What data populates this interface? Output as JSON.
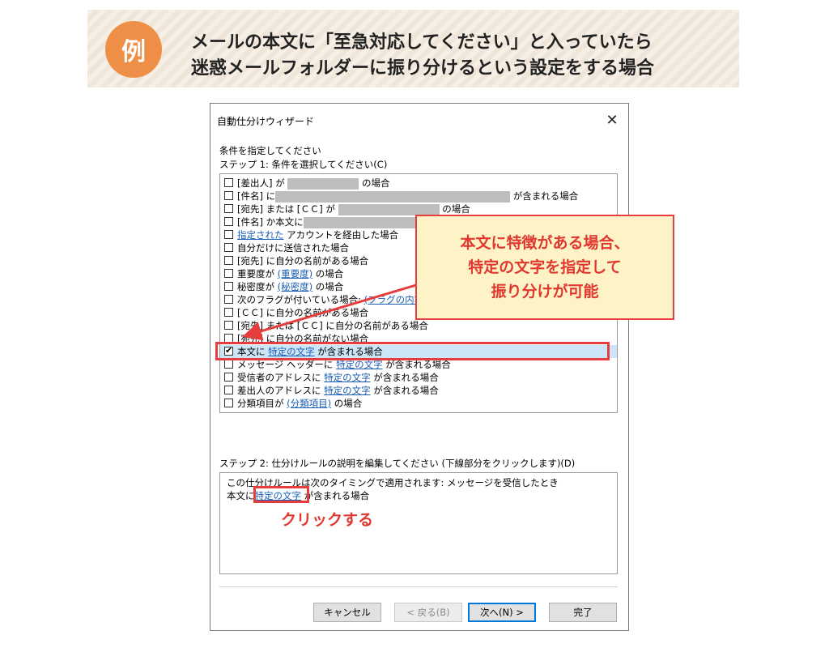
{
  "banner": {
    "badge": "例",
    "line1": "メールの本文に「至急対応してください」と入っていたら",
    "line2": "迷惑メールフォルダーに振り分けるという設定をする場合"
  },
  "dialog": {
    "title": "自動仕分けウィザード",
    "close_glyph": "✕",
    "instruction": "条件を指定してください",
    "step1": "ステップ 1: 条件を選択してください(C)",
    "rules": [
      {
        "pre": "[差出人] が",
        "link": "",
        "post": "の場合",
        "checked": false
      },
      {
        "pre": "[件名] に",
        "link": "",
        "post": "が含まれる場合",
        "checked": false
      },
      {
        "pre": "[宛先] または [ＣＣ] が",
        "link": "",
        "post": "の場合",
        "checked": false
      },
      {
        "pre": "[件名] か本文に",
        "link": "",
        "post": "",
        "checked": false
      },
      {
        "pre": "",
        "link": "指定された",
        "post": " アカウントを経由した場合",
        "checked": false
      },
      {
        "pre": "自分だけに送信された場合",
        "link": "",
        "post": "",
        "checked": false
      },
      {
        "pre": "[宛先] に自分の名前がある場合",
        "link": "",
        "post": "",
        "checked": false
      },
      {
        "pre": "重要度が ",
        "link": "(重要度)",
        "post": " の場合",
        "checked": false
      },
      {
        "pre": "秘密度が ",
        "link": "(秘密度)",
        "post": " の場合",
        "checked": false
      },
      {
        "pre": "次のフラグが付いている場合: ",
        "link": "(フラグの内容)",
        "post": "",
        "checked": false
      },
      {
        "pre": "[ＣＣ] に自分の名前がある場合",
        "link": "",
        "post": "",
        "checked": false
      },
      {
        "pre": "[宛先] または [ＣＣ] に自分の名前がある場合",
        "link": "",
        "post": "",
        "checked": false
      },
      {
        "pre": "[宛先] に自分の名前がない場合",
        "link": "",
        "post": "",
        "checked": false
      },
      {
        "pre": "本文に ",
        "link": "特定の文字",
        "post": " が含まれる場合",
        "checked": true
      },
      {
        "pre": "メッセージ ヘッダーに ",
        "link": "特定の文字",
        "post": " が含まれる場合",
        "checked": false
      },
      {
        "pre": "受信者のアドレスに ",
        "link": "特定の文字",
        "post": " が含まれる場合",
        "checked": false
      },
      {
        "pre": "差出人のアドレスに ",
        "link": "特定の文字",
        "post": " が含まれる場合",
        "checked": false
      },
      {
        "pre": "分類項目が ",
        "link": "(分類項目)",
        "post": " の場合",
        "checked": false
      }
    ],
    "step2": "ステップ 2: 仕分けルールの説明を編集してください (下線部分をクリックします)(D)",
    "desc_line1": "この仕分けルールは次のタイミングで適用されます: メッセージを受信したとき",
    "desc_line2_pre": "本文に",
    "desc_line2_link": "特定の文字",
    "desc_line2_post": " が含まれる場合",
    "buttons": {
      "cancel": "キャンセル",
      "back": "< 戻る(B)",
      "next": "次へ(N) >",
      "finish": "完了"
    }
  },
  "annotations": {
    "callout_line1": "本文に特徴がある場合、",
    "callout_line2": "特定の文字を指定して",
    "callout_line3": "振り分けが可能",
    "click_label": "クリックする",
    "accent_color": "#e63e3e",
    "callout_bg": "#fdf3c7",
    "badge_color": "#ef8f47"
  }
}
